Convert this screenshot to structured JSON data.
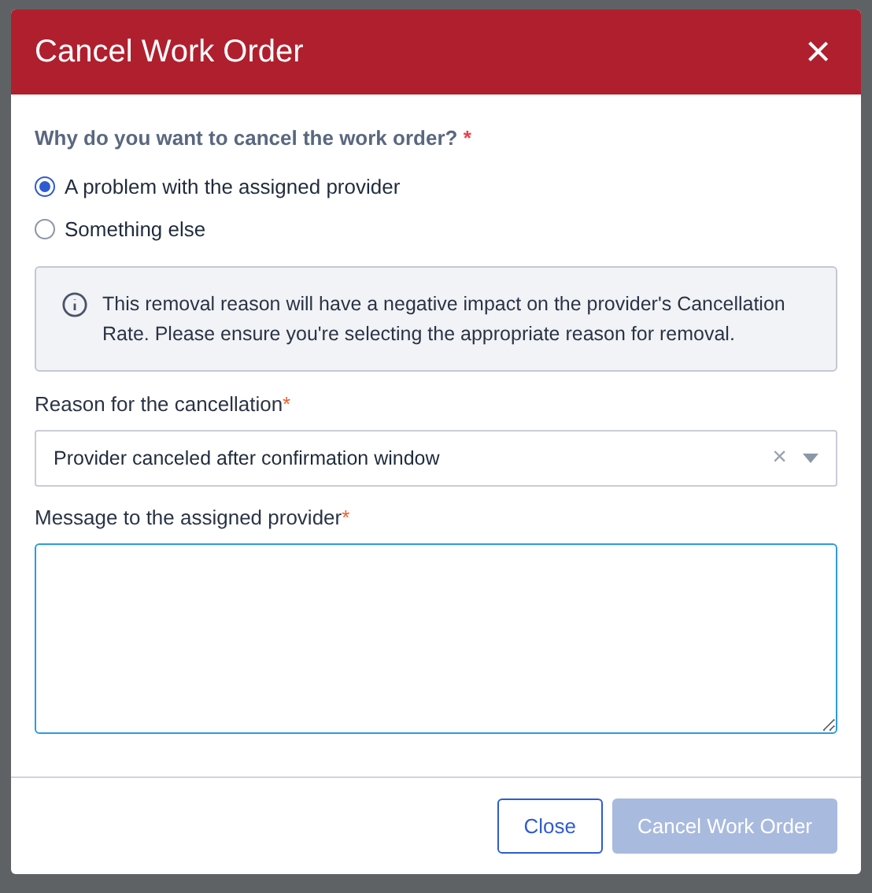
{
  "dialog": {
    "title": "Cancel Work Order",
    "close_icon": "×"
  },
  "question": {
    "label": "Why do you want to cancel the work order?",
    "required_mark": "*",
    "options": [
      {
        "label": "A problem with the assigned provider",
        "selected": true
      },
      {
        "label": "Something else",
        "selected": false
      }
    ]
  },
  "notice": {
    "text": "This removal reason will have a negative impact on the provider's Cancellation Rate. Please ensure you're selecting the appropriate reason for removal."
  },
  "reason": {
    "label": "Reason for the cancellation",
    "required_mark": "*",
    "value": "Provider canceled after confirmation window",
    "clear": "×"
  },
  "message": {
    "label": "Message to the assigned provider",
    "required_mark": "*",
    "focused": true
  },
  "buttons": [
    {
      "label": "Close",
      "kind": "secondary",
      "disabled": false
    },
    {
      "label": "Cancel Work Order",
      "kind": "primary",
      "disabled": true
    }
  ]
}
